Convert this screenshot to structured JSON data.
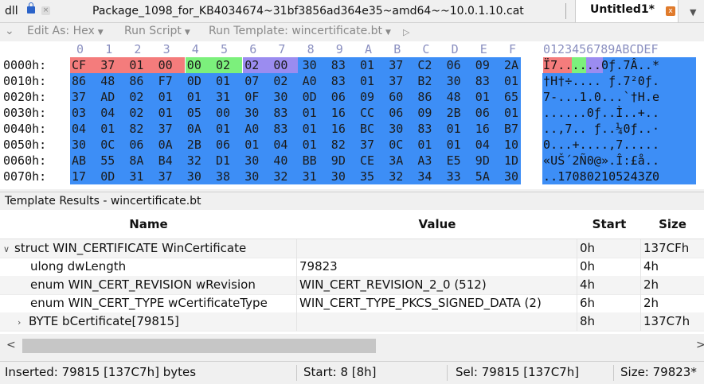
{
  "tabs": {
    "dll": "dll",
    "close_small": "×",
    "package": "Package_1098_for_KB4034674~31bf3856ad364e35~amd64~~10.0.1.10.cat",
    "untitled": "Untitled1*",
    "close_active": "x",
    "menu": "▼"
  },
  "toolbar": {
    "edit_as": "Edit As: Hex",
    "run_script": "Run Script",
    "run_template": "Run Template: wincertificate.bt",
    "play": "▷"
  },
  "hex": {
    "col_headers": [
      "0",
      "1",
      "2",
      "3",
      "4",
      "5",
      "6",
      "7",
      "8",
      "9",
      "A",
      "B",
      "C",
      "D",
      "E",
      "F"
    ],
    "ascii_header": "0123456789ABCDEF",
    "rows": [
      {
        "addr": "0000h:",
        "bytes": [
          "CF",
          "37",
          "01",
          "00",
          "00",
          "02",
          "02",
          "00",
          "30",
          "83",
          "01",
          "37",
          "C2",
          "06",
          "09",
          "2A"
        ],
        "ascii": "Ï7......0ƒ.7Â..*"
      },
      {
        "addr": "0010h:",
        "bytes": [
          "86",
          "48",
          "86",
          "F7",
          "0D",
          "01",
          "07",
          "02",
          "A0",
          "83",
          "01",
          "37",
          "B2",
          "30",
          "83",
          "01"
        ],
        "ascii": "†H†÷.... ƒ.7²0ƒ."
      },
      {
        "addr": "0020h:",
        "bytes": [
          "37",
          "AD",
          "02",
          "01",
          "01",
          "31",
          "0F",
          "30",
          "0D",
          "06",
          "09",
          "60",
          "86",
          "48",
          "01",
          "65"
        ],
        "ascii": "7-...1.0...`†H.e"
      },
      {
        "addr": "0030h:",
        "bytes": [
          "03",
          "04",
          "02",
          "01",
          "05",
          "00",
          "30",
          "83",
          "01",
          "16",
          "CC",
          "06",
          "09",
          "2B",
          "06",
          "01"
        ],
        "ascii": "......0ƒ..Ì..+.."
      },
      {
        "addr": "0040h:",
        "bytes": [
          "04",
          "01",
          "82",
          "37",
          "0A",
          "01",
          "A0",
          "83",
          "01",
          "16",
          "BC",
          "30",
          "83",
          "01",
          "16",
          "B7"
        ],
        "ascii": "..‚7.. ƒ..¼0ƒ..·"
      },
      {
        "addr": "0050h:",
        "bytes": [
          "30",
          "0C",
          "06",
          "0A",
          "2B",
          "06",
          "01",
          "04",
          "01",
          "82",
          "37",
          "0C",
          "01",
          "01",
          "04",
          "10"
        ],
        "ascii": "0...+....‚7....."
      },
      {
        "addr": "0060h:",
        "bytes": [
          "AB",
          "55",
          "8A",
          "B4",
          "32",
          "D1",
          "30",
          "40",
          "BB",
          "9D",
          "CE",
          "3A",
          "A3",
          "E5",
          "9D",
          "1D"
        ],
        "ascii": "«UŠ´2Ñ0@».Î:£å.."
      },
      {
        "addr": "0070h:",
        "bytes": [
          "17",
          "0D",
          "31",
          "37",
          "30",
          "38",
          "30",
          "32",
          "31",
          "30",
          "35",
          "32",
          "34",
          "33",
          "5A",
          "30"
        ],
        "ascii": "..170802105243Z0"
      }
    ]
  },
  "template_results": {
    "title": "Template Results - wincertificate.bt",
    "headers": {
      "name": "Name",
      "value": "Value",
      "start": "Start",
      "size": "Size"
    },
    "rows": [
      {
        "expander": "∨",
        "name": "struct WIN_CERTIFICATE WinCertificate",
        "value": "",
        "start": "0h",
        "size": "137CFh"
      },
      {
        "expander": "",
        "name": "ulong dwLength",
        "value": "79823",
        "start": "0h",
        "size": "4h"
      },
      {
        "expander": "",
        "name": "enum WIN_CERT_REVISION wRevision",
        "value": "WIN_CERT_REVISION_2_0 (512)",
        "start": "4h",
        "size": "2h"
      },
      {
        "expander": "",
        "name": "enum WIN_CERT_TYPE wCertificateType",
        "value": "WIN_CERT_TYPE_PKCS_SIGNED_DATA (2)",
        "start": "6h",
        "size": "2h"
      },
      {
        "expander": "›",
        "name": "BYTE bCertificate[79815]",
        "value": "",
        "start": "8h",
        "size": "137C7h"
      }
    ]
  },
  "scrollbar": {
    "left": "<",
    "right": ">"
  },
  "status": {
    "inserted": "Inserted: 79815 [137C7h] bytes",
    "start": "Start: 8 [8h]",
    "sel": "Sel: 79815 [137C7h]",
    "size": "Size: 79823*"
  },
  "colors": {
    "selection": "#3d8ef6",
    "field_dwLength": "#f47c7c",
    "field_wRevision": "#7cf07c",
    "field_wCertificateType": "#9b8cf0",
    "active_tab_close": "#e07b2c"
  }
}
